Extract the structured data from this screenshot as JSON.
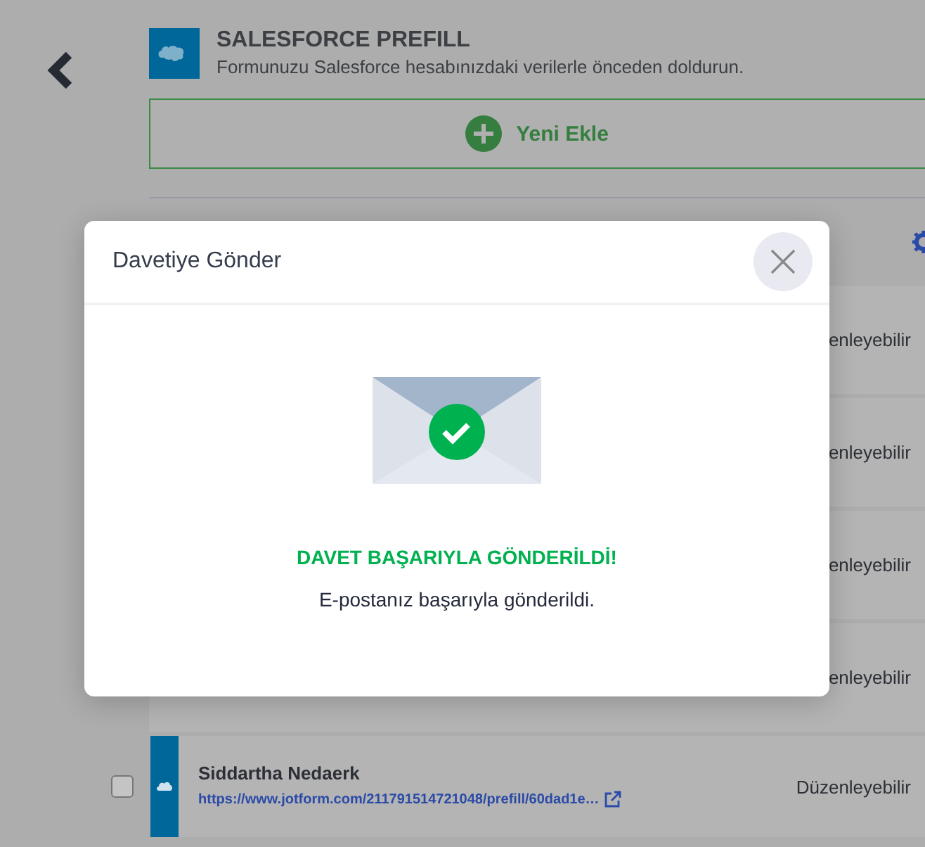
{
  "header": {
    "title": "SALESFORCE PREFILL",
    "subtitle": "Formunuzu Salesforce hesabınızdaki verilerle önceden doldurun."
  },
  "add_button": {
    "label": "Yeni Ekle"
  },
  "rows": [
    {
      "kind": "hidden",
      "permission": "enleyebilir"
    },
    {
      "kind": "hidden",
      "permission": "enleyebilir"
    },
    {
      "kind": "hidden",
      "permission": "enleyebilir"
    },
    {
      "kind": "hidden",
      "permission": "enleyebilir"
    },
    {
      "kind": "full",
      "checked": false,
      "name": "Siddartha Nedaerk",
      "link": "https://www.jotform.com/211791514721048/prefill/60dad1e…",
      "permission": "Düzenleyebilir"
    }
  ],
  "modal": {
    "title": "Davetiye Gönder",
    "heading": "DAVET BAŞARIYLA GÖNDERİLDİ!",
    "message": "E-postanız başarıyla gönderildi."
  }
}
